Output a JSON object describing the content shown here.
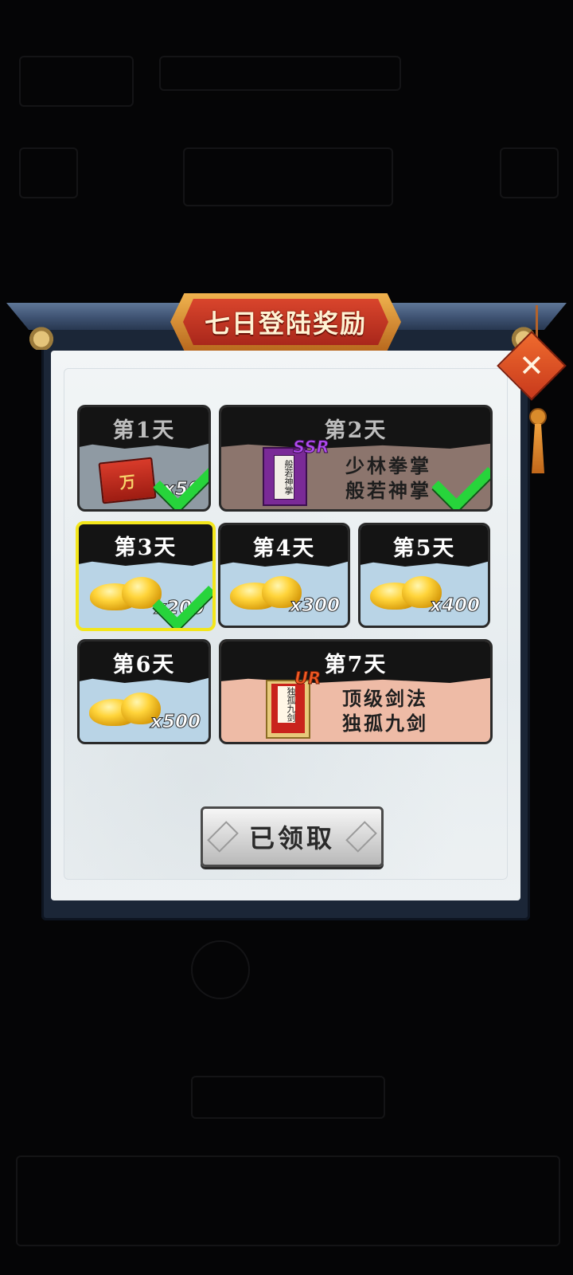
{
  "title": "七日登陆奖励",
  "close_icon": "✕",
  "rewards": [
    {
      "day": "第1天",
      "icon": "book-icon",
      "book_char": "万",
      "quantity": "x50",
      "claimed": true
    },
    {
      "day": "第2天",
      "icon": "purple-book-icon",
      "rarity": "SSR",
      "book_label": "般若神掌",
      "line1": "少林拳掌",
      "line2": "般若神掌",
      "claimed": true
    },
    {
      "day": "第3天",
      "icon": "gold-ingot-icon",
      "quantity": "x200",
      "claimed": true,
      "selected": true
    },
    {
      "day": "第4天",
      "icon": "gold-ingot-icon",
      "quantity": "x300",
      "claimed": false
    },
    {
      "day": "第5天",
      "icon": "gold-ingot-icon",
      "quantity": "x400",
      "claimed": false
    },
    {
      "day": "第6天",
      "icon": "gold-ingot-icon",
      "quantity": "x500",
      "claimed": false
    },
    {
      "day": "第7天",
      "icon": "red-book-icon",
      "rarity": "UR",
      "book_label": "独孤九剑",
      "line1": "顶级剑法",
      "line2": "独孤九剑",
      "claimed": false
    }
  ],
  "claim_button": {
    "label": "已领取"
  },
  "colors": {
    "selected_border": "#f3e61b",
    "check": "#27d43b",
    "title_red": "#c4321f"
  }
}
